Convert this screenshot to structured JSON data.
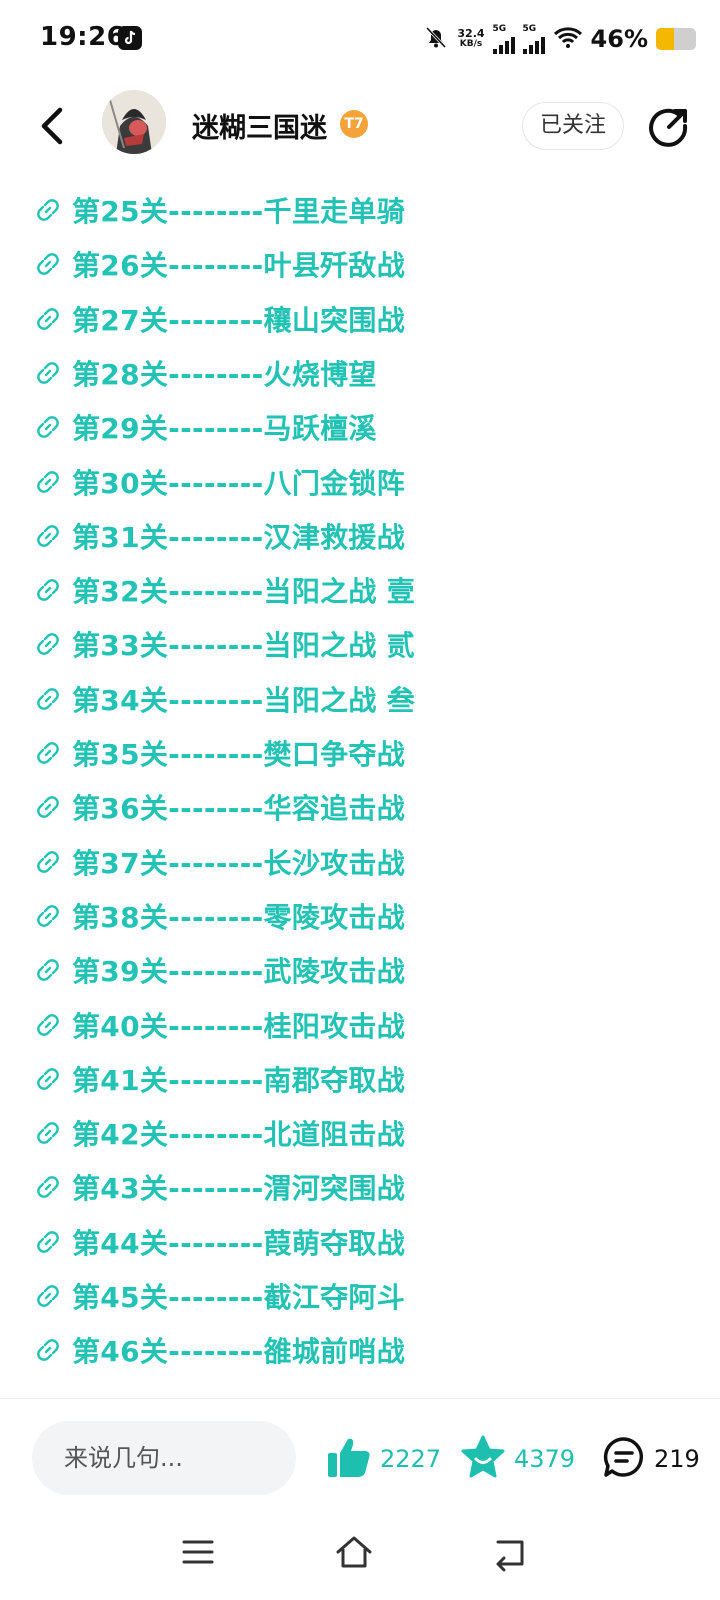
{
  "status_bar": {
    "time": "19:26",
    "net_speed_value": "32.4",
    "net_speed_unit": "KB/s",
    "sim1_label": "5G",
    "sim2_label": "5G",
    "battery_text": "46%",
    "battery_level": 0.46,
    "battery_color": "#f5b800"
  },
  "header": {
    "username": "迷糊三国迷",
    "badge_text": "T7",
    "follow_label": "已关注",
    "accent": "#22c3b4"
  },
  "content": {
    "partial_top_text": "—  —  —  —  —",
    "links": [
      {
        "label": "第25关--------千里走单骑"
      },
      {
        "label": "第26关--------叶县歼敌战"
      },
      {
        "label": "第27关--------穰山突围战"
      },
      {
        "label": "第28关--------火烧博望"
      },
      {
        "label": "第29关--------马跃檀溪"
      },
      {
        "label": "第30关--------八门金锁阵"
      },
      {
        "label": "第31关--------汉津救援战"
      },
      {
        "label": "第32关--------当阳之战 壹"
      },
      {
        "label": "第33关--------当阳之战 贰"
      },
      {
        "label": "第34关--------当阳之战 叁"
      },
      {
        "label": "第35关--------樊口争夺战"
      },
      {
        "label": "第36关--------华容追击战"
      },
      {
        "label": "第37关--------长沙攻击战"
      },
      {
        "label": "第38关--------零陵攻击战"
      },
      {
        "label": "第39关--------武陵攻击战"
      },
      {
        "label": "第40关--------桂阳攻击战"
      },
      {
        "label": "第41关--------南郡夺取战"
      },
      {
        "label": "第42关--------北道阻击战"
      },
      {
        "label": "第43关--------渭河突围战"
      },
      {
        "label": "第44关--------葭萌夺取战"
      },
      {
        "label": "第45关--------截江夺阿斗"
      },
      {
        "label": "第46关--------雒城前哨战"
      }
    ]
  },
  "bottom_bar": {
    "comment_placeholder": "来说几句...",
    "like_count": "2227",
    "favorite_count": "4379",
    "comment_count": "219"
  }
}
